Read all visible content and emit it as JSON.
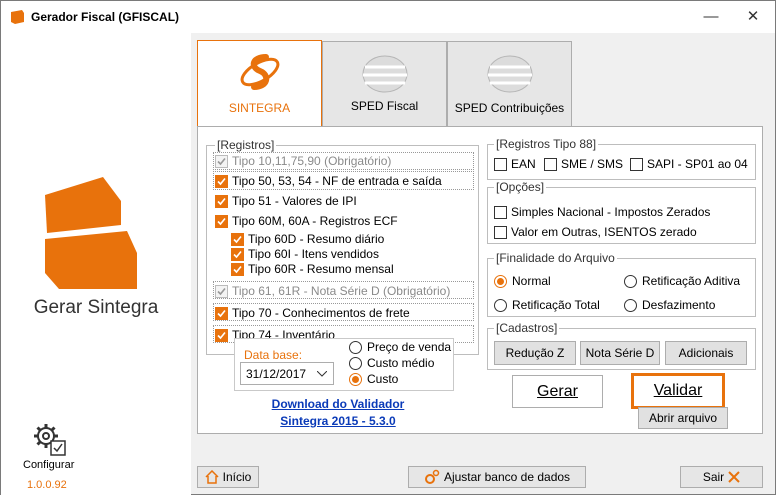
{
  "window": {
    "title": "Gerador Fiscal (GFISCAL)",
    "minimize": "—",
    "close": "✕"
  },
  "sidebar": {
    "brand_text": "Gerar Sintegra",
    "config_label": "Configurar",
    "version": "1.0.0.92"
  },
  "tabs": [
    {
      "label": "SINTEGRA",
      "active": true
    },
    {
      "label": "SPED Fiscal",
      "active": false
    },
    {
      "label": "SPED Contribuições",
      "active": false
    }
  ],
  "registros": {
    "legend": "[Registros]",
    "items": [
      {
        "label": "Tipo 10,11,75,90 (Obrigatório)",
        "checked": true,
        "disabled": true
      },
      {
        "label": "Tipo 50, 53, 54 - NF de entrada e saída",
        "checked": true,
        "disabled": false
      },
      {
        "label": "Tipo 51 - Valores de IPI",
        "checked": true,
        "disabled": false
      },
      {
        "label": "Tipo 60M, 60A - Registros ECF",
        "checked": true,
        "disabled": false
      },
      {
        "label": "Tipo 60D - Resumo diário",
        "checked": true,
        "disabled": false
      },
      {
        "label": "Tipo 60I - Itens vendidos",
        "checked": true,
        "disabled": false
      },
      {
        "label": "Tipo 60R - Resumo mensal",
        "checked": true,
        "disabled": false
      },
      {
        "label": "Tipo 61, 61R - Nota Série D (Obrigatório)",
        "checked": true,
        "disabled": true
      },
      {
        "label": "Tipo 70 - Conhecimentos de frete",
        "checked": true,
        "disabled": false
      },
      {
        "label": "Tipo 74 - Inventário",
        "checked": true,
        "disabled": false
      }
    ],
    "data_base_label": "Data base:",
    "data_base_value": "31/12/2017",
    "inventario_options": [
      {
        "label": "Preço de venda",
        "selected": false
      },
      {
        "label": "Custo médio",
        "selected": false
      },
      {
        "label": "Custo",
        "selected": true
      }
    ]
  },
  "download_link": {
    "line1": "Download do Validador",
    "line2": "Sintegra 2015 - 5.3.0"
  },
  "tipo88": {
    "legend": "[Registros Tipo 88]",
    "items": [
      {
        "label": "EAN",
        "checked": false
      },
      {
        "label": "SME / SMS",
        "checked": false
      },
      {
        "label": "SAPI - SP01 ao 04",
        "checked": false
      }
    ]
  },
  "opcoes": {
    "legend": "[Opções]",
    "items": [
      {
        "label": "Simples Nacional - Impostos Zerados",
        "checked": false
      },
      {
        "label": "Valor em Outras, ISENTOS zerado",
        "checked": false
      }
    ]
  },
  "finalidade": {
    "legend": "[Finalidade do Arquivo",
    "options": [
      {
        "label": "Normal",
        "selected": true
      },
      {
        "label": "Retificação Aditiva",
        "selected": false
      },
      {
        "label": "Retificação Total",
        "selected": false
      },
      {
        "label": "Desfazimento",
        "selected": false
      }
    ]
  },
  "cadastros": {
    "legend": "[Cadastros]",
    "buttons": [
      "Redução Z",
      "Nota Série D",
      "Adicionais"
    ]
  },
  "actions": {
    "gerar": "Gerar",
    "validar": "Validar",
    "abrir": "Abrir arquivo"
  },
  "footer": {
    "inicio": "Início",
    "ajustar": "Ajustar banco de dados",
    "sair": "Sair"
  },
  "colors": {
    "accent": "#e8720c",
    "link": "#0a3ab8"
  }
}
